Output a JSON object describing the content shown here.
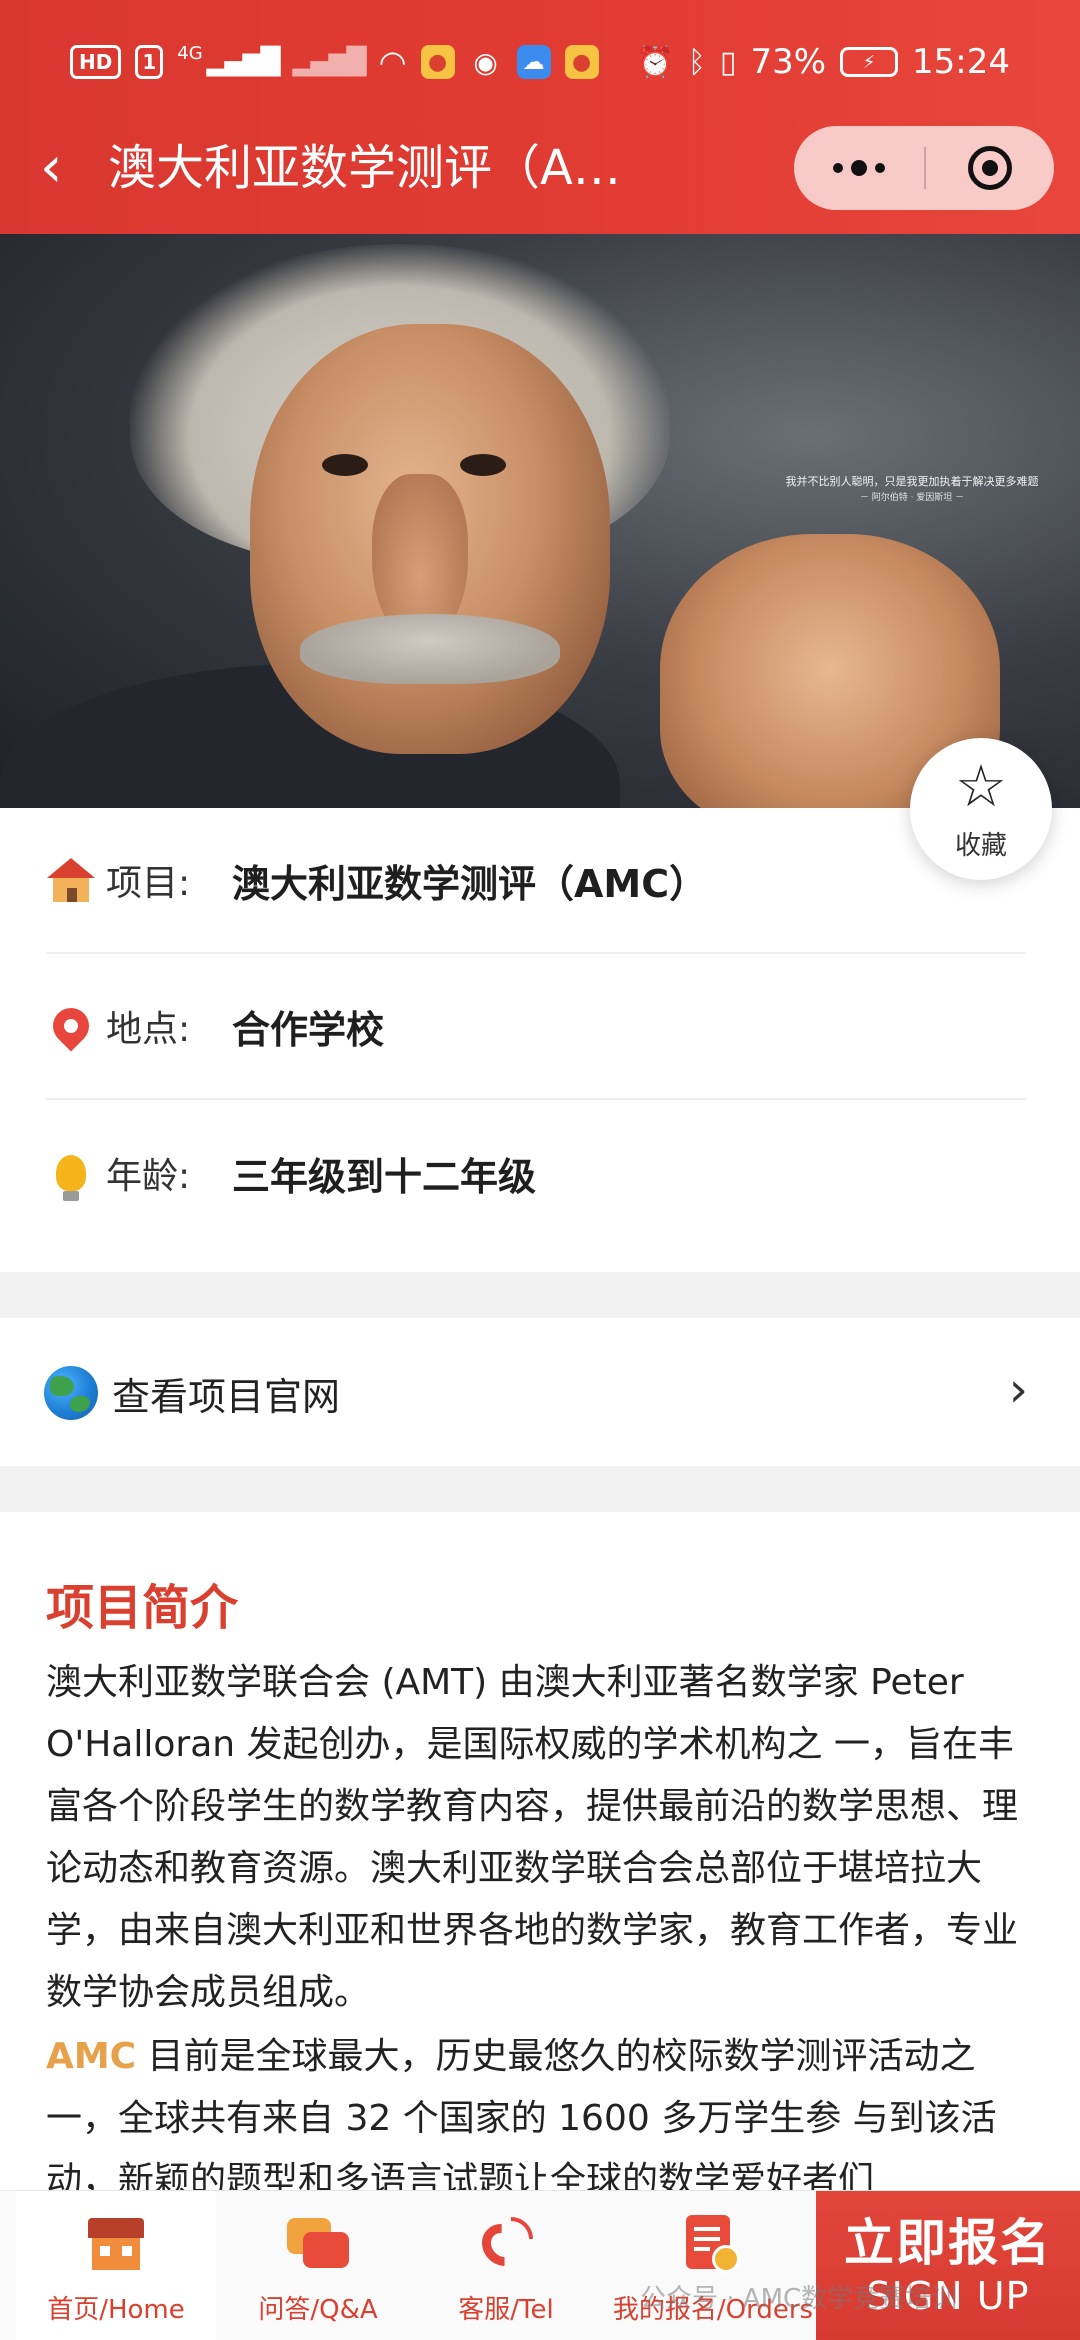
{
  "status_bar": {
    "hd_label": "HD",
    "sim_slot": "1",
    "network_type": "4G",
    "battery_percent": "73%",
    "time": "15:24"
  },
  "nav": {
    "title": "澳大利亚数学测评（A…"
  },
  "hero": {
    "quote_line": "我并不比别人聪明，只是我更加执着于解决更多难题",
    "quote_author": "－ 阿尔伯特 · 爱因斯坦 －"
  },
  "favorite": {
    "label": "收藏"
  },
  "info": {
    "rows": [
      {
        "key": "项目:",
        "value": "澳大利亚数学测评（AMC）",
        "icon": "house-icon"
      },
      {
        "key": "地点:",
        "value": "合作学校",
        "icon": "location-pin-icon"
      },
      {
        "key": "年龄:",
        "value": "三年级到十二年级",
        "icon": "lightbulb-icon"
      }
    ]
  },
  "website_link": {
    "label": "查看项目官网"
  },
  "intro": {
    "heading": "项目简介",
    "paragraph1": "澳大利亚数学联合会 (AMT) 由澳大利亚著名数学家 Peter O'Halloran 发起创办，是国际权威的学术机构之 一，旨在丰富各个阶段学生的数学教育内容，提供最前沿的数学思想、理论动态和教育资源。澳大利亚数学联合会总部位于堪培拉大学，由来自澳大利亚和世界各地的数学家，教育工作者，专业数学协会成员组成。",
    "paragraph2_highlight": "AMC",
    "paragraph2_rest": " 目前是全球最大，历史最悠久的校际数学测评活动之一，全球共有来自 32 个国家的 1600 多万学生参 与到该活动，新颖的题型和多语言试题让全球的数学爱好者们"
  },
  "tabbar": {
    "tabs": [
      {
        "label": "首页/Home",
        "icon": "home-icon"
      },
      {
        "label": "问答/Q&A",
        "icon": "chat-bubbles-icon"
      },
      {
        "label": "客服/Tel",
        "icon": "phone-icon"
      },
      {
        "label": "我的报名/Orders",
        "icon": "orders-icon"
      }
    ],
    "signup_cn": "立即报名",
    "signup_en": "SIGN UP"
  },
  "watermark": "公众号 · AMC数学竞赛培训",
  "colors": {
    "brand_red": "#d9402f",
    "highlight_orange": "#e6a14a"
  }
}
